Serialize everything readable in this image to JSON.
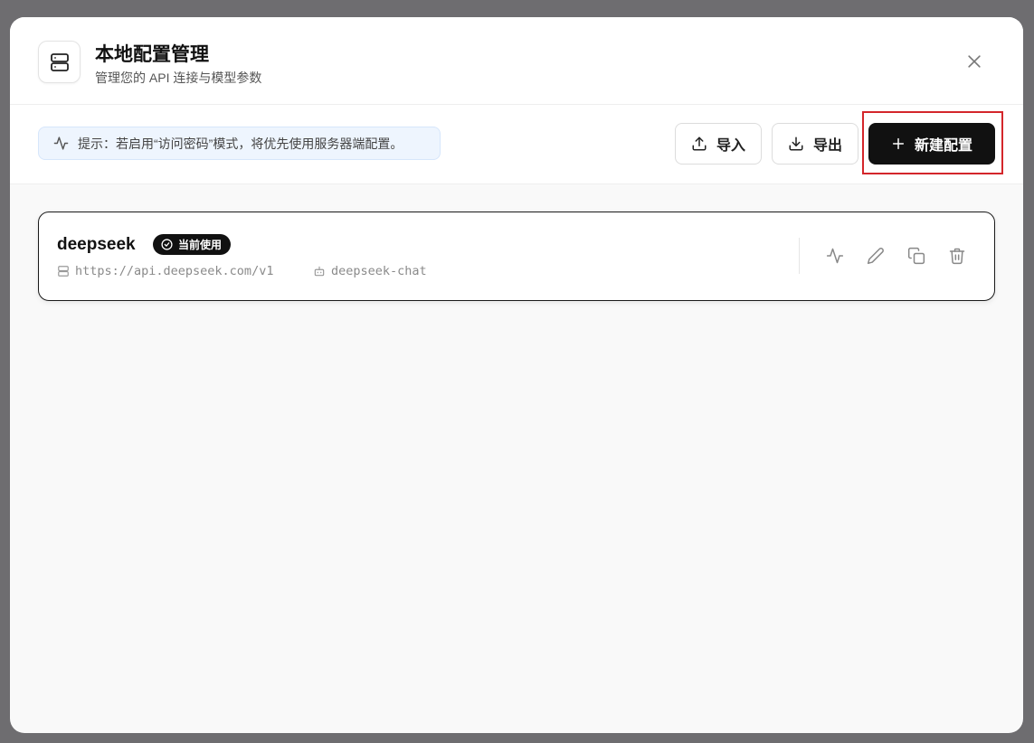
{
  "header": {
    "title": "本地配置管理",
    "subtitle": "管理您的 API 连接与模型参数",
    "icon": "server-icon",
    "close_icon": "close-icon"
  },
  "toolbar": {
    "hint": "提示：若启用“访问密码”模式，将优先使用服务器端配置。",
    "import_label": "导入",
    "export_label": "导出",
    "new_label": "新建配置"
  },
  "configs": [
    {
      "name": "deepseek",
      "badge": "当前使用",
      "url": "https://api.deepseek.com/v1",
      "model": "deepseek-chat",
      "actions": [
        "activity-icon",
        "edit-icon",
        "copy-icon",
        "trash-icon"
      ]
    }
  ],
  "colors": {
    "backdrop": "#6e6d70",
    "primary": "#111111",
    "hint_bg": "#eef5fe",
    "highlight": "#d4262b"
  }
}
